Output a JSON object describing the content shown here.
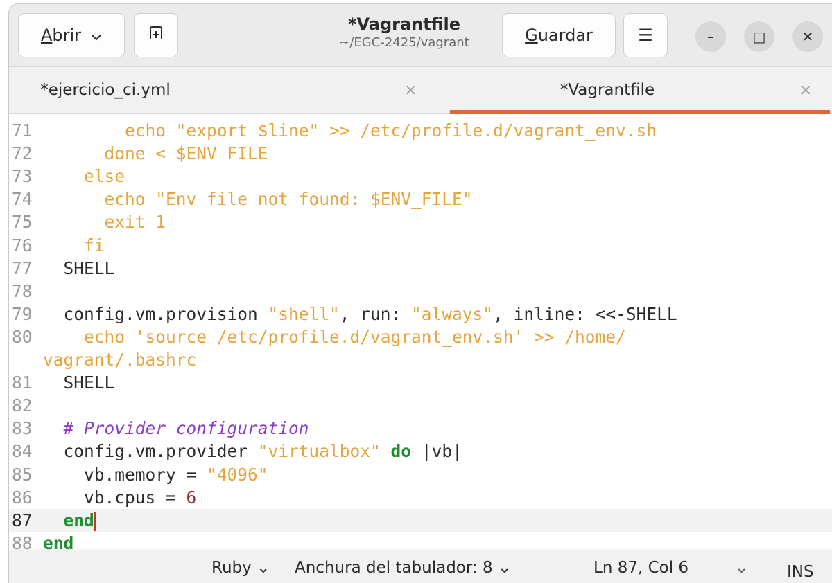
{
  "header": {
    "open_label_mnemonic": "A",
    "open_label_rest": "brir",
    "new_tab_icon": "new-tab-icon",
    "title": "*Vagrantfile",
    "subtitle": "~/EGC-2425/vagrant",
    "save_label_mnemonic": "G",
    "save_label_rest": "uardar",
    "menu_icon": "☰",
    "minimize": "–",
    "maximize": "□",
    "close": "✕"
  },
  "tabs": [
    {
      "label": "*ejercicio_ci.yml",
      "close": "×",
      "active": false
    },
    {
      "label": "*Vagrantfile",
      "close": "×",
      "active": true
    }
  ],
  "editor": {
    "accent_color": "#e2643b",
    "current_line": "87",
    "lines": [
      {
        "n": "71",
        "segments": [
          {
            "t": "      ",
            "c": ""
          },
          {
            "t": "  echo \"export $line\" >> /etc/profile.d/vagrant_env.sh",
            "c": "s"
          }
        ]
      },
      {
        "n": "72",
        "segments": [
          {
            "t": "      ",
            "c": ""
          },
          {
            "t": "done < $ENV_FILE",
            "c": "s"
          }
        ]
      },
      {
        "n": "73",
        "segments": [
          {
            "t": "    ",
            "c": ""
          },
          {
            "t": "else",
            "c": "s"
          }
        ]
      },
      {
        "n": "74",
        "segments": [
          {
            "t": "      ",
            "c": ""
          },
          {
            "t": "echo \"Env file not found: $ENV_FILE\"",
            "c": "s"
          }
        ]
      },
      {
        "n": "75",
        "segments": [
          {
            "t": "      ",
            "c": ""
          },
          {
            "t": "exit 1",
            "c": "s"
          }
        ]
      },
      {
        "n": "76",
        "segments": [
          {
            "t": "    ",
            "c": ""
          },
          {
            "t": "fi",
            "c": "s"
          }
        ]
      },
      {
        "n": "77",
        "segments": [
          {
            "t": "  SHELL",
            "c": ""
          }
        ]
      },
      {
        "n": "78",
        "segments": []
      },
      {
        "n": "79",
        "segments": [
          {
            "t": "  config.vm.provision ",
            "c": ""
          },
          {
            "t": "\"shell\"",
            "c": "s"
          },
          {
            "t": ", run: ",
            "c": ""
          },
          {
            "t": "\"always\"",
            "c": "s"
          },
          {
            "t": ", inline: <<-SHELL",
            "c": ""
          }
        ]
      },
      {
        "n": "80",
        "segments": [
          {
            "t": "    ",
            "c": ""
          },
          {
            "t": "echo 'source /etc/profile.d/vagrant_env.sh' >> /home/",
            "c": "s"
          }
        ]
      },
      {
        "n": "",
        "segments": [
          {
            "t": "vagrant/.bashrc",
            "c": "s"
          }
        ]
      },
      {
        "n": "81",
        "segments": [
          {
            "t": "  SHELL",
            "c": ""
          }
        ]
      },
      {
        "n": "82",
        "segments": []
      },
      {
        "n": "83",
        "segments": [
          {
            "t": "  ",
            "c": ""
          },
          {
            "t": "# Provider configuration",
            "c": "c"
          }
        ]
      },
      {
        "n": "84",
        "segments": [
          {
            "t": "  config.vm.provider ",
            "c": ""
          },
          {
            "t": "\"virtualbox\"",
            "c": "s"
          },
          {
            "t": " ",
            "c": ""
          },
          {
            "t": "do",
            "c": "k"
          },
          {
            "t": " |vb|",
            "c": ""
          }
        ]
      },
      {
        "n": "85",
        "segments": [
          {
            "t": "    vb.memory = ",
            "c": ""
          },
          {
            "t": "\"4096\"",
            "c": "s"
          }
        ]
      },
      {
        "n": "86",
        "segments": [
          {
            "t": "    vb.cpus = ",
            "c": ""
          },
          {
            "t": "6",
            "c": "n"
          }
        ]
      },
      {
        "n": "87",
        "segments": [
          {
            "t": "  ",
            "c": ""
          },
          {
            "t": "end",
            "c": "k"
          }
        ]
      },
      {
        "n": "88",
        "segments": [
          {
            "t": "end",
            "c": "k"
          }
        ]
      }
    ]
  },
  "status": {
    "language": "Ruby",
    "tab_width": "Anchura del tabulador: 8",
    "position": "Ln 87, Col 6",
    "mode": "INS",
    "chevron": "⌄"
  }
}
